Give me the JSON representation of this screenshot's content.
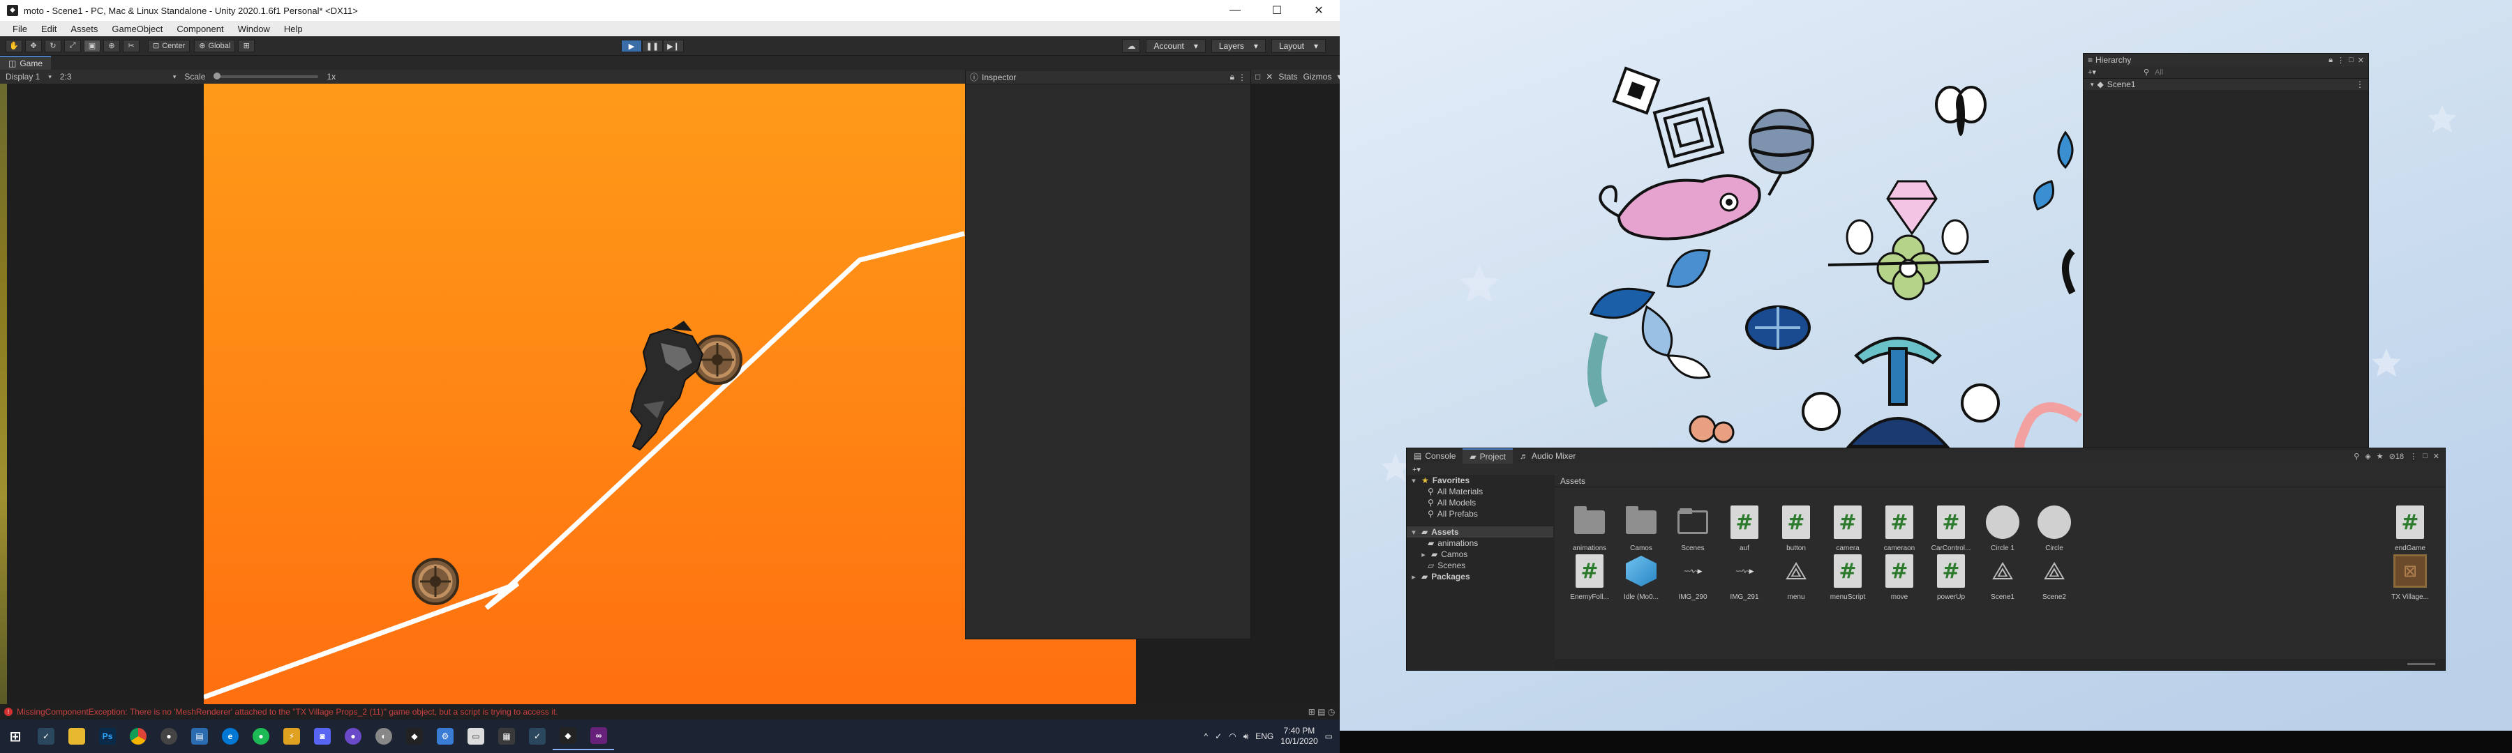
{
  "window": {
    "title": "moto - Scene1 - PC, Mac & Linux Standalone - Unity 2020.1.6f1 Personal* <DX11>",
    "minimize": "—",
    "maximize": "☐",
    "close": "✕"
  },
  "menu": [
    "File",
    "Edit",
    "Assets",
    "GameObject",
    "Component",
    "Window",
    "Help"
  ],
  "toolbar": {
    "pivot_center": "Center",
    "pivot_global": "Global",
    "account": "Account",
    "layers": "Layers",
    "layout": "Layout"
  },
  "game": {
    "tab": "Game",
    "display": "Display 1",
    "aspect": "2:3",
    "scale_label": "Scale",
    "scale_value": "1x",
    "stats": "Stats",
    "gizmos": "Gizmos"
  },
  "inspector": {
    "tab": "Inspector"
  },
  "status": {
    "error": "MissingComponentException: There is no 'MeshRenderer' attached to the \"TX Village Props_2 (11)\" game object, but a script is trying to access it."
  },
  "taskbar_left": {
    "language": "ENG",
    "time": "7:40 PM",
    "date": "10/1/2020"
  },
  "hierarchy": {
    "tab": "Hierarchy",
    "search_placeholder": "All",
    "scene": "Scene1"
  },
  "project": {
    "tabs": [
      "Console",
      "Project",
      "Audio Mixer"
    ],
    "tree": {
      "favorites": "Favorites",
      "fav_items": [
        "All Materials",
        "All Models",
        "All Prefabs"
      ],
      "assets": "Assets",
      "asset_folders": [
        "animations",
        "Camos",
        "Scenes"
      ],
      "packages": "Packages"
    },
    "breadcrumb": "Assets",
    "items_row1": [
      {
        "label": "animations",
        "kind": "folder"
      },
      {
        "label": "Camos",
        "kind": "folder"
      },
      {
        "label": "Scenes",
        "kind": "folder-hollow"
      },
      {
        "label": "auf",
        "kind": "script"
      },
      {
        "label": "button",
        "kind": "script"
      },
      {
        "label": "camera",
        "kind": "script"
      },
      {
        "label": "cameraon",
        "kind": "script"
      },
      {
        "label": "CarControl...",
        "kind": "script"
      },
      {
        "label": "Circle 1",
        "kind": "circle"
      },
      {
        "label": "Circle",
        "kind": "circle"
      }
    ],
    "items_row2": [
      {
        "label": "EnemyFoll...",
        "kind": "script"
      },
      {
        "label": "Idle (Mo0...",
        "kind": "cube"
      },
      {
        "label": "IMG_290",
        "kind": "image"
      },
      {
        "label": "IMG_291",
        "kind": "image"
      },
      {
        "label": "menu",
        "kind": "unity"
      },
      {
        "label": "menuScript",
        "kind": "script"
      },
      {
        "label": "move",
        "kind": "script"
      },
      {
        "label": "powerUp",
        "kind": "script"
      },
      {
        "label": "Scene1",
        "kind": "unity"
      },
      {
        "label": "Scene2",
        "kind": "unity"
      }
    ],
    "edge_row1": {
      "label": "endGame",
      "kind": "script"
    },
    "edge_row2": {
      "label": "TX Village...",
      "kind": "texture"
    }
  },
  "colors": {
    "game_bg": "#ff8413",
    "editor_bg": "#191919",
    "accent": "#4a7cc0",
    "error": "#d23030"
  }
}
